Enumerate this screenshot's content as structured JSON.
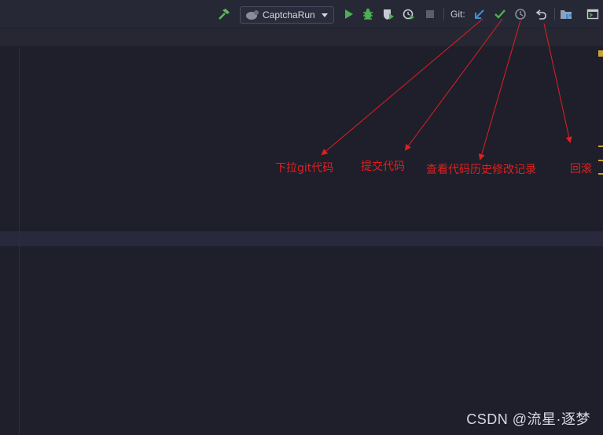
{
  "toolbar": {
    "run_config_label": "CaptchaRun",
    "git_label": "Git:",
    "icons": [
      "build-hammer-icon",
      "run-config-icon",
      "run-icon",
      "debug-icon",
      "coverage-icon",
      "profile-icon",
      "stop-icon",
      "git-update-icon",
      "git-commit-icon",
      "git-history-icon",
      "git-rollback-icon",
      "project-structure-icon",
      "terminal-icon"
    ]
  },
  "annotations": {
    "pull": "下拉git代码",
    "commit": "提交代码",
    "history": "查看代码历史修改记录",
    "rollback": "回滚"
  },
  "watermark": "CSDN @流星·逐梦",
  "colors": {
    "annotation": "#e02020",
    "run_green": "#4caf50",
    "git_blue": "#3d8fd6",
    "editor_bg": "#1e1f2b"
  }
}
